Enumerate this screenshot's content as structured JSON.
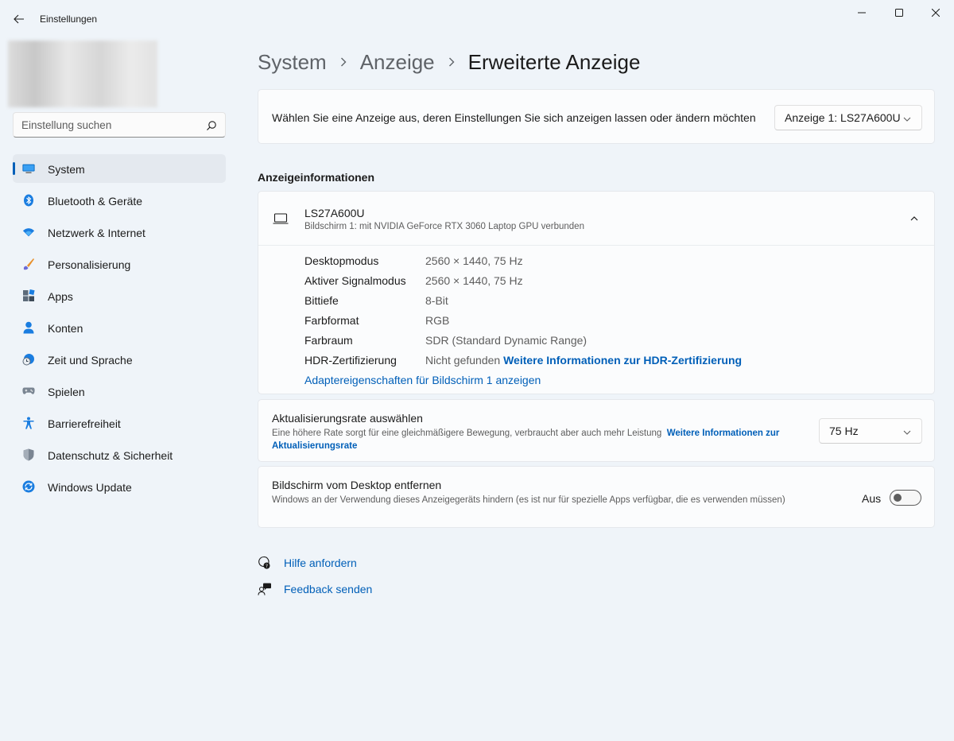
{
  "window": {
    "title": "Einstellungen",
    "controls": {
      "minimize": "minimize-icon",
      "maximize": "maximize-icon",
      "close": "close-icon"
    }
  },
  "sidebar": {
    "search_placeholder": "Einstellung suchen",
    "items": [
      {
        "label": "System",
        "icon": "monitor-icon",
        "active": true
      },
      {
        "label": "Bluetooth & Geräte",
        "icon": "bluetooth-icon"
      },
      {
        "label": "Netzwerk & Internet",
        "icon": "wifi-icon"
      },
      {
        "label": "Personalisierung",
        "icon": "brush-icon"
      },
      {
        "label": "Apps",
        "icon": "apps-icon"
      },
      {
        "label": "Konten",
        "icon": "account-icon"
      },
      {
        "label": "Zeit und Sprache",
        "icon": "clock-globe-icon"
      },
      {
        "label": "Spielen",
        "icon": "gamepad-icon"
      },
      {
        "label": "Barrierefreiheit",
        "icon": "accessibility-icon"
      },
      {
        "label": "Datenschutz & Sicherheit",
        "icon": "shield-icon"
      },
      {
        "label": "Windows Update",
        "icon": "update-icon"
      }
    ]
  },
  "breadcrumb": {
    "items": [
      "System",
      "Anzeige"
    ],
    "current": "Erweiterte Anzeige"
  },
  "display_select": {
    "text": "Wählen Sie eine Anzeige aus, deren Einstellungen Sie sich anzeigen lassen oder ändern möchten",
    "selected": "Anzeige 1: LS27A600U"
  },
  "display_info": {
    "section_title": "Anzeigeinformationen",
    "monitor_name": "LS27A600U",
    "monitor_subtitle": "Bildschirm 1: mit NVIDIA GeForce RTX 3060 Laptop GPU verbunden",
    "properties": [
      {
        "key": "Desktopmodus",
        "value": "2560 × 1440, 75 Hz"
      },
      {
        "key": "Aktiver Signalmodus",
        "value": "2560 × 1440, 75 Hz"
      },
      {
        "key": "Bittiefe",
        "value": "8-Bit"
      },
      {
        "key": "Farbformat",
        "value": "RGB"
      },
      {
        "key": "Farbraum",
        "value": "SDR (Standard Dynamic Range)"
      },
      {
        "key": "HDR-Zertifizierung",
        "value": "Nicht gefunden",
        "link": "Weitere Informationen zur HDR-Zertifizierung"
      }
    ],
    "adapter_link": "Adaptereigenschaften für Bildschirm 1 anzeigen"
  },
  "refresh_rate": {
    "title": "Aktualisierungsrate auswählen",
    "description": "Eine höhere Rate sorgt für eine gleichmäßigere Bewegung, verbraucht aber auch mehr Leistung",
    "link": "Weitere Informationen zur Aktualisierungsrate",
    "selected": "75 Hz"
  },
  "remove_display": {
    "title": "Bildschirm vom Desktop entfernen",
    "description": "Windows an der Verwendung dieses Anzeigegeräts hindern (es ist nur für spezielle Apps verfügbar, die es verwenden müssen)",
    "toggle_label": "Aus",
    "toggle_on": false
  },
  "help": {
    "get_help": "Hilfe anfordern",
    "feedback": "Feedback senden"
  },
  "colors": {
    "accent": "#005fb8",
    "background": "#eff4f9",
    "card": "#fbfcfd"
  }
}
